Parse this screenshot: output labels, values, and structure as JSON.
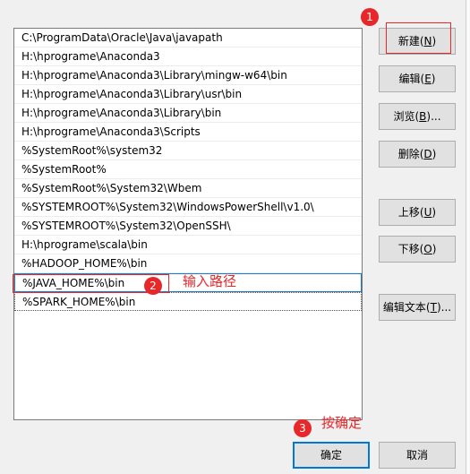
{
  "paths": [
    "C:\\ProgramData\\Oracle\\Java\\javapath",
    "H:\\hprograme\\Anaconda3",
    "H:\\hprograme\\Anaconda3\\Library\\mingw-w64\\bin",
    "H:\\hprograme\\Anaconda3\\Library\\usr\\bin",
    "H:\\hprograme\\Anaconda3\\Library\\bin",
    "H:\\hprograme\\Anaconda3\\Scripts",
    "%SystemRoot%\\system32",
    "%SystemRoot%",
    "%SystemRoot%\\System32\\Wbem",
    "%SYSTEMROOT%\\System32\\WindowsPowerShell\\v1.0\\",
    "%SYSTEMROOT%\\System32\\OpenSSH\\",
    "H:\\hprograme\\scala\\bin",
    "%HADOOP_HOME%\\bin",
    "%JAVA_HOME%\\bin",
    "%SPARK_HOME%\\bin"
  ],
  "buttons": {
    "new": {
      "text": "新建(",
      "acc": "N",
      "tail": ")"
    },
    "edit": {
      "text": "编辑(",
      "acc": "E",
      "tail": ")"
    },
    "browse": {
      "text": "浏览(",
      "acc": "B",
      "tail": ")..."
    },
    "delete": {
      "text": "删除(",
      "acc": "D",
      "tail": ")"
    },
    "up": {
      "text": "上移(",
      "acc": "U",
      "tail": ")"
    },
    "down": {
      "text": "下移(",
      "acc": "O",
      "tail": ")"
    },
    "edit_text": {
      "text": "编辑文本(",
      "acc": "T",
      "tail": ")..."
    },
    "ok": "确定",
    "cancel": "取消"
  },
  "annotations": {
    "badge1": "1",
    "badge2": "2",
    "badge3": "3",
    "input_path": "输入路径",
    "press_ok": "按确定"
  },
  "colors": {
    "annotation": "#e8272a",
    "focus": "#0078d7"
  }
}
